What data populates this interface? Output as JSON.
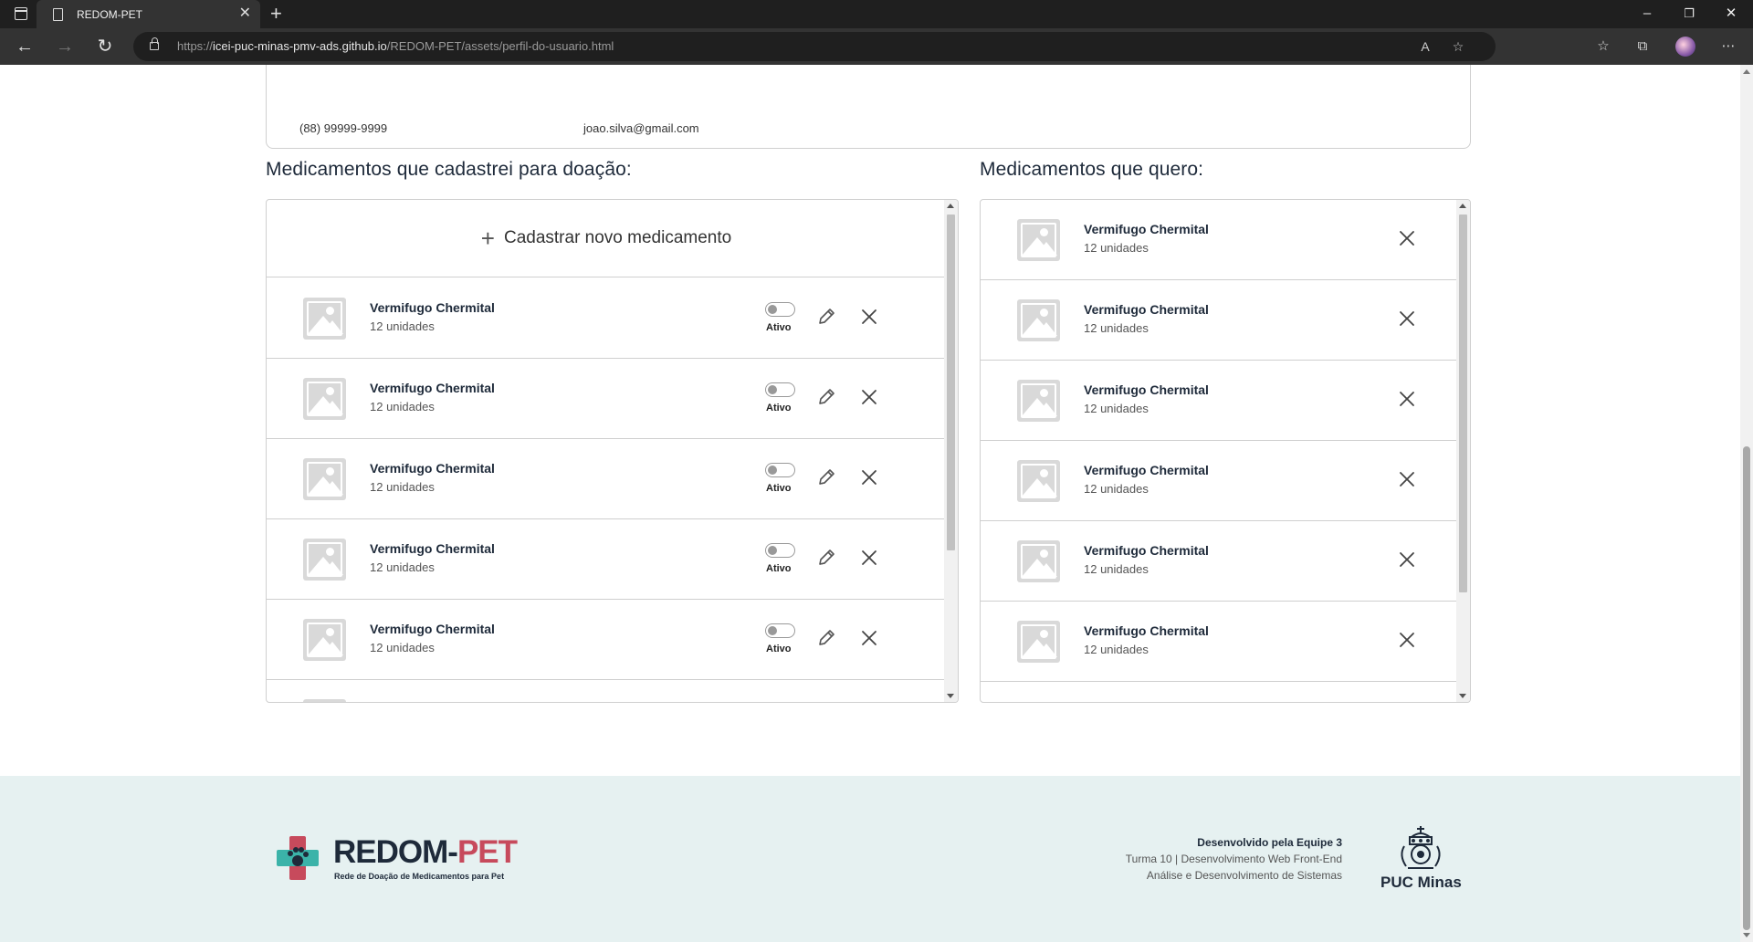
{
  "browser": {
    "tab_title": "REDOM-PET",
    "url_prefix": "https://",
    "url_host": "icei-puc-minas-pmv-ads.github.io",
    "url_path": "/REDOM-PET/assets/perfil-do-usuario.html"
  },
  "profile": {
    "phone": "(88) 99999-9999",
    "email": "joao.silva@gmail.com"
  },
  "donations": {
    "title": "Medicamentos que cadastrei para doação:",
    "add_label": "Cadastrar novo medicamento",
    "toggle_label": "Ativo",
    "items": [
      {
        "name": "Vermifugo Chermital",
        "qty": "12 unidades",
        "active": false
      },
      {
        "name": "Vermifugo Chermital",
        "qty": "12 unidades",
        "active": false
      },
      {
        "name": "Vermifugo Chermital",
        "qty": "12 unidades",
        "active": false
      },
      {
        "name": "Vermifugo Chermital",
        "qty": "12 unidades",
        "active": false
      },
      {
        "name": "Vermifugo Chermital",
        "qty": "12 unidades",
        "active": false
      }
    ]
  },
  "wanted": {
    "title": "Medicamentos que quero:",
    "items": [
      {
        "name": "Vermifugo Chermital",
        "qty": "12 unidades"
      },
      {
        "name": "Vermifugo Chermital",
        "qty": "12 unidades"
      },
      {
        "name": "Vermifugo Chermital",
        "qty": "12 unidades"
      },
      {
        "name": "Vermifugo Chermital",
        "qty": "12 unidades"
      },
      {
        "name": "Vermifugo Chermital",
        "qty": "12 unidades"
      },
      {
        "name": "Vermifugo Chermital",
        "qty": "12 unidades"
      }
    ]
  },
  "footer": {
    "logo_part1": "REDOM-",
    "logo_part2": "PET",
    "logo_tagline": "Rede de Doação de Medicamentos para Pet",
    "credit_title": "Desenvolvido pela Equipe 3",
    "credit_line1": "Turma 10 | Desenvolvimento Web Front-End",
    "credit_line2": "Análise e Desenvolvimento de Sistemas",
    "university": "PUC Minas"
  },
  "colors": {
    "text_dark": "#1e2a3a",
    "accent_pink": "#c74a5c",
    "accent_teal": "#3bb3a9",
    "footer_bg": "#e6f1f1"
  },
  "icons": [
    "window-icon",
    "page-icon",
    "close-icon",
    "plus-icon",
    "back-icon",
    "forward-icon",
    "reload-icon",
    "lock-icon",
    "read-aloud-icon",
    "favorite-add-icon",
    "favorites-icon",
    "collections-icon",
    "menu-icon",
    "pencil-icon",
    "image-placeholder-icon"
  ]
}
